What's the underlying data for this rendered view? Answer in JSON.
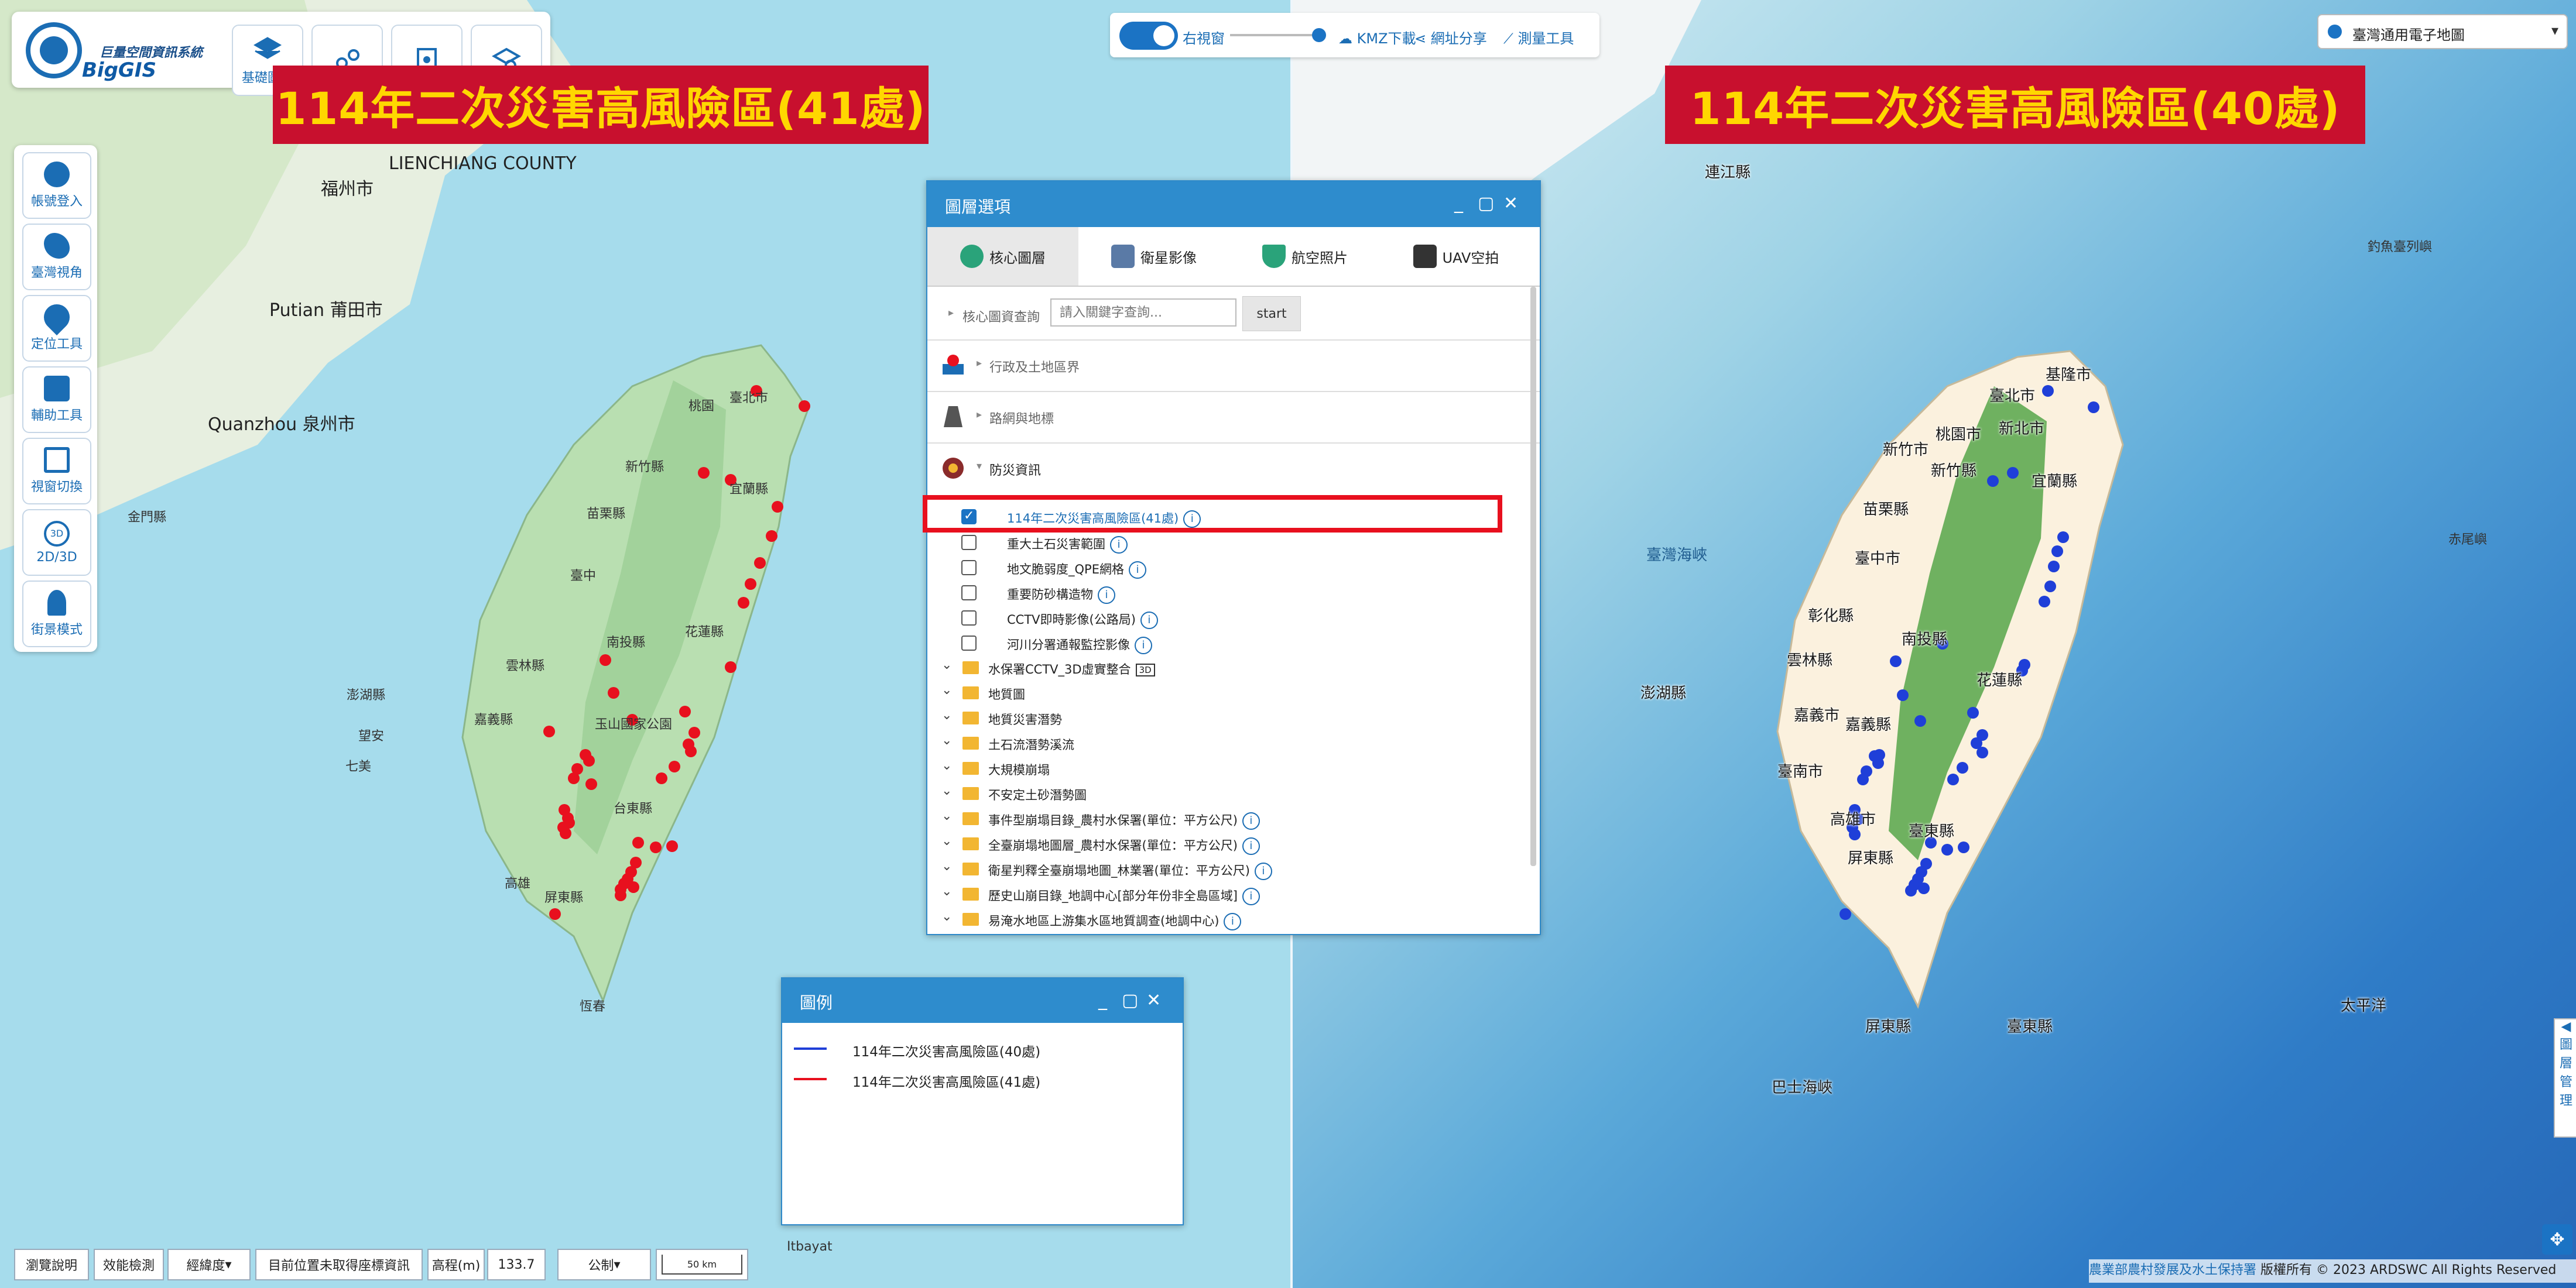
{
  "app": {
    "logo_title": "巨量空間資訊系統",
    "logo_brand": "BigGIS"
  },
  "top_buttons": [
    "基礎圖層"
  ],
  "banners": {
    "left": "114年二次災害高風險區(41處)",
    "right": "114年二次災害高風險區(40處)"
  },
  "side_tools": [
    {
      "label": "帳號登入",
      "icon": "user-icon"
    },
    {
      "label": "臺灣視角",
      "icon": "taiwan-icon"
    },
    {
      "label": "定位工具",
      "icon": "location-pin-icon"
    },
    {
      "label": "輔助工具",
      "icon": "map-tool-icon"
    },
    {
      "label": "視窗切換",
      "icon": "window-icon"
    },
    {
      "label": "2D/3D",
      "icon": "rotate-3d-icon"
    },
    {
      "label": "街景模式",
      "icon": "street-view-icon"
    }
  ],
  "center_toolbar": {
    "window_label": "右視窗",
    "kmz": "KMZ下載",
    "share": "網址分享",
    "measure": "測量工具"
  },
  "basemap": {
    "selected": "臺灣通用電子地圖"
  },
  "layer_panel": {
    "title": "圖層選項",
    "tabs": [
      {
        "label": "核心圖層",
        "icon": "core-layer-icon"
      },
      {
        "label": "衛星影像",
        "icon": "satellite-icon"
      },
      {
        "label": "航空照片",
        "icon": "airplane-icon"
      },
      {
        "label": "UAV空拍",
        "icon": "drone-icon"
      }
    ],
    "query": {
      "label": "核心圖資查詢",
      "placeholder": "請入關鍵字查詢...",
      "button": "start"
    },
    "sections": [
      "行政及土地區界",
      "路網與地標",
      "防災資訊"
    ],
    "items": [
      {
        "label": "114年二次災害高風險區(41處)",
        "checked": true
      },
      {
        "label": "重大土石災害範圍",
        "checked": false
      },
      {
        "label": "地文脆弱度_QPE網格",
        "checked": false
      },
      {
        "label": "重要防砂構造物",
        "checked": false
      },
      {
        "label": "CCTV即時影像(公路局)",
        "checked": false
      },
      {
        "label": "河川分署通報監控影像",
        "checked": false
      }
    ],
    "folders": [
      "水保署CCTV_3D虛實整合",
      "地質圖",
      "地質災害潛勢",
      "土石流潛勢溪流",
      "大規模崩塌",
      "不安定土砂潛勢圖",
      "事件型崩塌目錄_農村水保署(單位：平方公尺)",
      "全臺崩塌地圖層_農村水保署(單位：平方公尺)",
      "衛星判釋全臺崩塌地圖_林業署(單位：平方公尺)",
      "歷史山崩目錄_地調中心[部分年份非全島區域]",
      "易淹水地區上游集水區地質調查(地調中心)"
    ],
    "badge_3d": "3D"
  },
  "legend": {
    "title": "圖例",
    "entries": [
      {
        "label": "114年二次災害高風險區(40處)",
        "color": "#1f3fd8"
      },
      {
        "label": "114年二次災害高風險區(41處)",
        "color": "#e8101e"
      }
    ]
  },
  "bottom_bar": {
    "help": "瀏覽說明",
    "perf": "效能檢測",
    "coord_type": "經緯度",
    "position": "目前位置未取得座標資訊",
    "elev_label": "高程(m)",
    "elev_value": "133.7",
    "unit": "公制",
    "scale": "50 km"
  },
  "copyright": {
    "agency": "農業部農村發展及水土保持署",
    "rights": "版權所有 © 2023 ARDSWC All Rights Reserved"
  },
  "right_side_tab": "◀ 圖層管理",
  "map_labels_left": [
    "LIENCHIANG COUNTY",
    "福州市",
    "Putian 莆田市",
    "Quanzhou 泉州市",
    "金門縣",
    "澎湖縣",
    "望安",
    "七美",
    "臺北市",
    "新竹縣",
    "桃園",
    "宜蘭縣",
    "苗栗縣",
    "臺中",
    "南投縣",
    "花蓮縣",
    "雲林縣",
    "嘉義縣",
    "玉山國家公園",
    "台東縣",
    "高雄",
    "屏東縣",
    "恆春",
    "Itbayat"
  ],
  "map_labels_right": [
    "連江縣",
    "臺灣海峽",
    "澎湖縣",
    "基隆市",
    "臺北市",
    "新北市",
    "桃園市",
    "新竹市",
    "新竹縣",
    "宜蘭縣",
    "苗栗縣",
    "臺中市",
    "彰化縣",
    "南投縣",
    "花蓮縣",
    "雲林縣",
    "嘉義市",
    "嘉義縣",
    "臺南市",
    "高雄市",
    "臺東縣",
    "屏東縣",
    "屏東縣",
    "臺東縣",
    "巴士海峽",
    "太平洋",
    "釣魚臺列嶼",
    "赤尾嶼"
  ],
  "colors": {
    "panel_header": "#2e8ccd",
    "banner_bg": "#c8102e",
    "banner_text": "#ffd700",
    "marker_red": "#e8101e",
    "marker_blue": "#1f3fd8"
  },
  "markers_left_count": 41,
  "markers_right_count": 40
}
